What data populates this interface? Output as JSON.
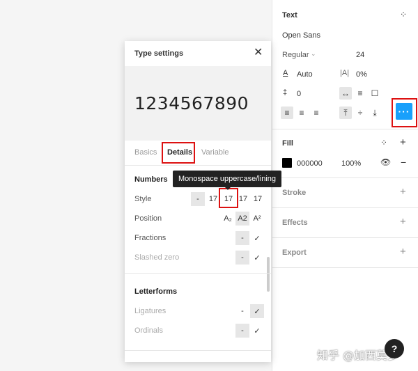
{
  "text_section": {
    "title": "Text",
    "font_family": "Open Sans",
    "weight": "Regular",
    "size": "24",
    "line_height": "Auto",
    "letter_spacing": "0%",
    "paragraph_spacing": "0"
  },
  "fill_section": {
    "title": "Fill",
    "hex": "000000",
    "opacity": "100%",
    "color": "#000000"
  },
  "other_sections": {
    "stroke": "Stroke",
    "effects": "Effects",
    "export": "Export"
  },
  "type_settings": {
    "title": "Type settings",
    "preview": "1234567890",
    "tabs": [
      "Basics",
      "Details",
      "Variable"
    ],
    "numbers_heading": "Numbers",
    "style_label": "Style",
    "style_options": [
      "-",
      "17",
      "17",
      "17",
      "17"
    ],
    "position_label": "Position",
    "position_options": [
      "A₂",
      "A2",
      "A²"
    ],
    "fractions_label": "Fractions",
    "slashed_zero_label": "Slashed zero",
    "letterforms_heading": "Letterforms",
    "ligatures_label": "Ligatures",
    "ordinals_label": "Ordinals",
    "dash": "-",
    "check": "✓",
    "tooltip": "Monospace uppercase/lining"
  },
  "watermark": "知乎 @加西莫多",
  "help": "?",
  "accent_color": "#18a0fb",
  "highlight_color": "#dd1111"
}
